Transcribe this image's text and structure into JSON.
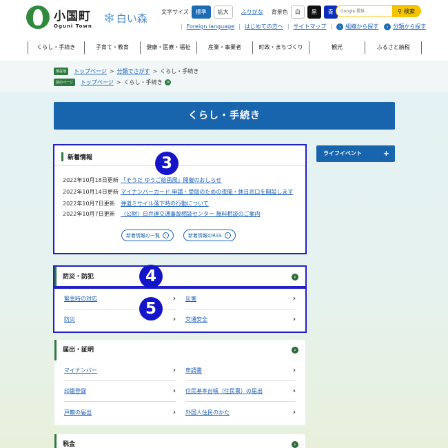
{
  "header": {
    "logo_title": "小国町",
    "logo_sub": "Oguni Town",
    "shiroi": "白い森",
    "font_size_label": "文字サイズ",
    "size_standard": "標準",
    "size_large": "拡大",
    "furigana": "ふりがな",
    "bg_label": "背景色",
    "bg_white": "白",
    "bg_black": "黒",
    "bg_blue": "青",
    "search_placeholder": "Google 提供",
    "search_button": "検索",
    "links": [
      "Foreign language",
      "はじめての方へ",
      "サイトマップ"
    ],
    "find_by_org": "組織から探す",
    "find_by_cat": "分類から探す"
  },
  "gnav": [
    "くらし・手続き",
    "子育て・教育",
    "健康・医療・福祉",
    "産業・事業者",
    "町政・まちづくり",
    "観光",
    "ふるさと納税"
  ],
  "breadcrumb": {
    "tag1": "現在地",
    "tag2": "前のページ",
    "row1": [
      "トップページ",
      "分類でさがす",
      "くらし・手続き"
    ],
    "row2": [
      "トップページ",
      "くらし・手続き"
    ]
  },
  "page_title": "くらし・手続き",
  "news": {
    "heading": "新着情報",
    "items": [
      {
        "date": "2022年10月18日更新",
        "title": "「そうだ ゆうご絵画展」開催のおしらせ"
      },
      {
        "date": "2022年10月14日更新",
        "title": "マイナンバーカード 申請・受取のための夜間・休日窓口を開設します"
      },
      {
        "date": "2022年10月7日更新",
        "title": "弾道ミサイル落下時の行動について"
      },
      {
        "date": "2022年10月7日更新",
        "title": "（公財）日弁連交通事故相談センター 無料相談のご案内"
      }
    ],
    "list_button": "新着情報の一覧",
    "rss_button": "新着情報のRSS"
  },
  "life_event": "ライフイベント",
  "sections": [
    {
      "title": "防災・防犯",
      "items": [
        "緊急時の対応",
        "災害",
        "防災",
        "交通安全"
      ]
    },
    {
      "title": "届出・証明",
      "items": [
        "マイナンバー",
        "申請書",
        "印鑑登録",
        "住民基本台帳（住民票）の届出",
        "戸籍の届出",
        "外国人住民のかた"
      ]
    },
    {
      "title": "税金",
      "items": []
    }
  ],
  "annotations": [
    "3",
    "4",
    "5"
  ]
}
